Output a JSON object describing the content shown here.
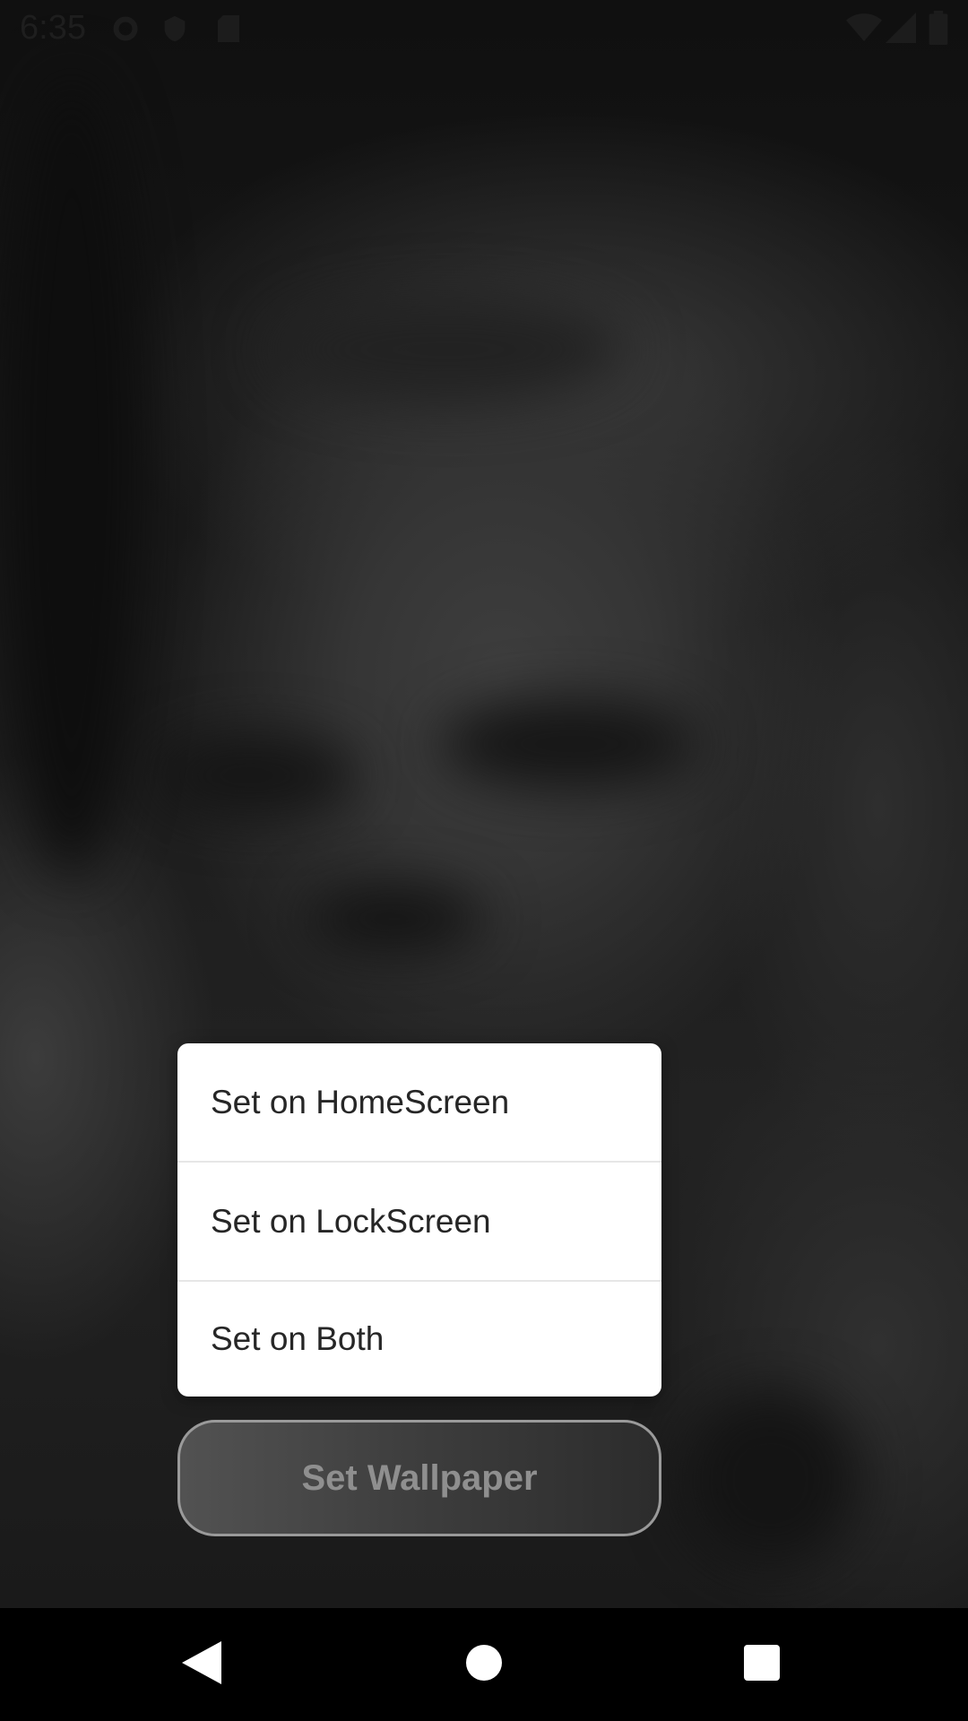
{
  "status_bar": {
    "time": "6:35",
    "icons": [
      "gear-icon",
      "shield-icon",
      "sd-card-icon",
      "wifi-icon",
      "signal-icon",
      "battery-icon"
    ]
  },
  "wallpaper_menu": {
    "items": [
      {
        "label": "Set on HomeScreen"
      },
      {
        "label": "Set on LockScreen"
      },
      {
        "label": "Set on Both"
      }
    ]
  },
  "set_wallpaper_button": {
    "label": "Set Wallpaper"
  },
  "nav_bar": {
    "buttons": [
      "back-icon",
      "home-icon",
      "recents-icon"
    ]
  },
  "colors": {
    "menu_background": "#ffffff",
    "menu_text": "#262626",
    "button_text": "#8f8f8f",
    "nav_background": "#000000"
  }
}
